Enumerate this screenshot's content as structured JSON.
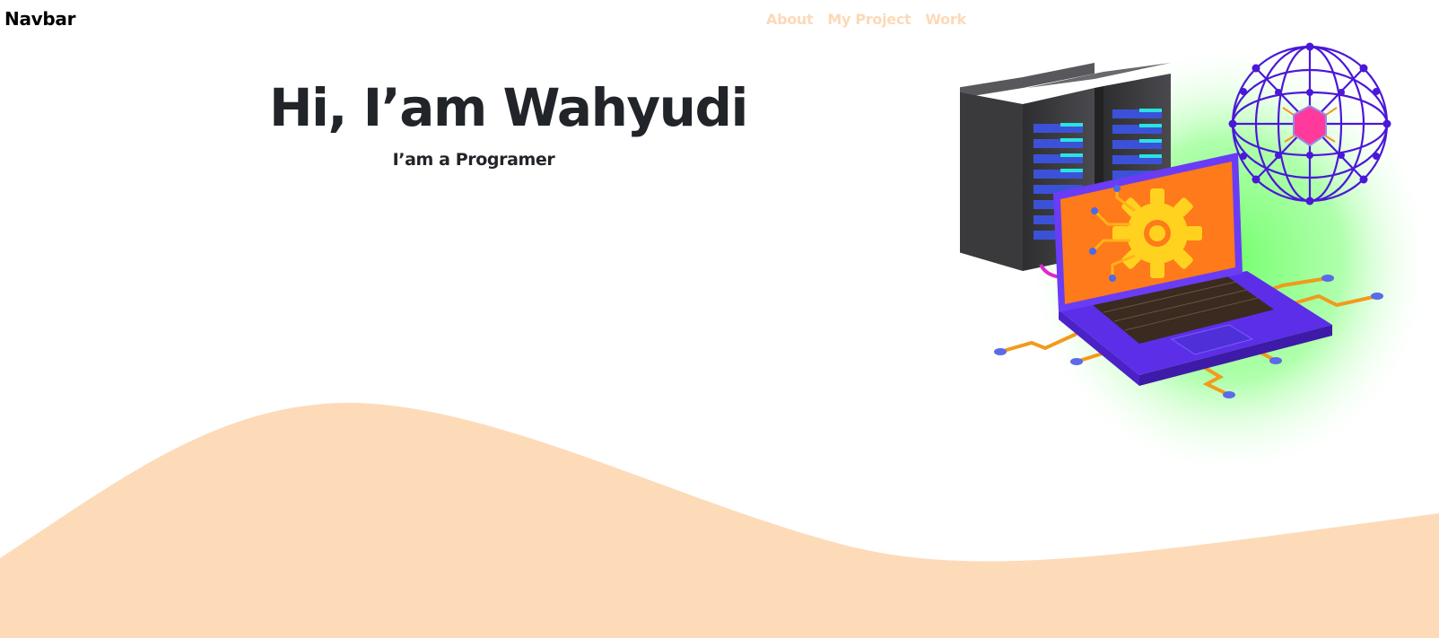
{
  "navbar": {
    "brand": "Navbar",
    "links": [
      "About",
      "My Project",
      "Work"
    ]
  },
  "hero": {
    "title": "Hi, I’am Wahyudi",
    "subtitle": "I’am a Programer"
  },
  "illustration": {
    "icon": "server-laptop-network-illustration"
  },
  "colors": {
    "nav_link": "#fcd9b8",
    "wave": "#fddbb9",
    "text": "#212529",
    "glow": "#7dff7a",
    "laptop_body": "#6a3cf5",
    "laptop_screen": "#ff7a1a",
    "gear": "#ffd21f",
    "server": "#3a3a3c"
  }
}
